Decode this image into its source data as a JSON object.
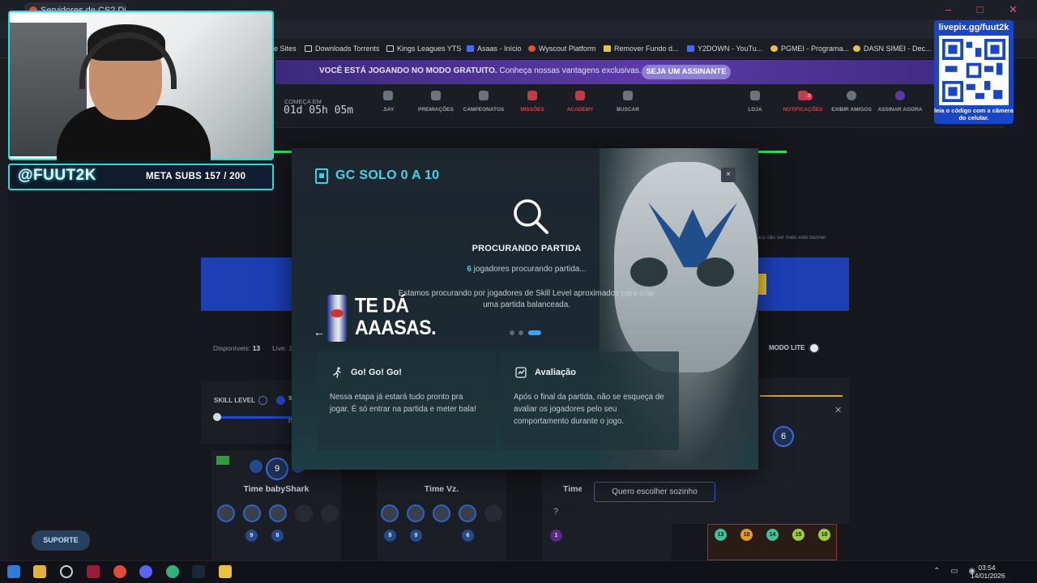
{
  "browser": {
    "tab_title": "Servidores de CS2 Dispo...",
    "window_controls": "– □ ✕",
    "bookmarks": [
      {
        "label": "e Sites",
        "icon": "folder-icon"
      },
      {
        "label": "Downloads Torrents",
        "icon": "folder-icon"
      },
      {
        "label": "Kings Leagues YTS",
        "icon": "folder-icon"
      },
      {
        "label": "Asaas - Início",
        "icon": "asaas-icon"
      },
      {
        "label": "Wyscout Platform",
        "icon": "wyscout-icon"
      },
      {
        "label": "Remover Fundo d...",
        "icon": "remover-icon"
      },
      {
        "label": "Y2DOWN - YouTu...",
        "icon": "y2down-icon"
      },
      {
        "label": "PGMEI - Programa...",
        "icon": "pgmei-icon"
      },
      {
        "label": "DASN SIMEI - Dec...",
        "icon": "dasn-icon"
      }
    ]
  },
  "promo": {
    "text_bold": "VOCÊ ESTÁ JOGANDO NO MODO GRATUITO.",
    "text": " Conheça nossas vantagens exclusivas.",
    "button": "SEJA UM ASSINANTE"
  },
  "nav": {
    "countdown_label": "COMEÇA EM",
    "countdown": "01d 05h 05m",
    "items": [
      {
        "label": ".SAY"
      },
      {
        "label": "PREMIAÇÕES"
      },
      {
        "label": "CAMPEONATOS"
      },
      {
        "label": "MISSÕES"
      },
      {
        "label": "ACADEMY"
      },
      {
        "label": "BUSCAR"
      },
      {
        "label": "LOJA"
      },
      {
        "label": "NOTIFICAÇÕES"
      },
      {
        "label": "EXIBIR AMIGOS"
      },
      {
        "label": "ASSINAR AGORA"
      }
    ],
    "notif_count": "3"
  },
  "overlay": {
    "handle": "@FUUT2K",
    "meta_label": "META SUBS",
    "meta_current": "157",
    "meta_total": "/ 200",
    "qr_title": "livepix.gg/fuut2k",
    "qr_caption": "leia o código com a câmera do celular."
  },
  "page": {
    "banner_note": "ara não ver mais este banner",
    "disponiveis_label": "Disponíveis:",
    "disponiveis_value": "13",
    "live_label": "Live: 1",
    "modo_lite": "MODO LITE",
    "skill_level": "SKILL LEVEL",
    "skill_frag": "s",
    "skill_frag2": "n",
    "teams": [
      {
        "name": "Time babyShark",
        "level": "9",
        "member_levels": [
          "9",
          "8"
        ]
      },
      {
        "name": "Time Vz.",
        "member_levels": [
          "8",
          "9",
          "6"
        ]
      },
      {
        "name": "Time",
        "member_levels": [
          "1"
        ]
      }
    ],
    "right_level": "6",
    "sozinho": "Quero escolher sozinho",
    "bottom_levels": [
      "13",
      "10",
      "14",
      "15",
      "10"
    ],
    "suporte": "SUPORTE"
  },
  "modal": {
    "title": "GC SOLO 0 A 10",
    "status": "PROCURANDO PARTIDA",
    "players_count": "6",
    "players_text": " jogadores procurando partida...",
    "description": "Estamos procurando por jogadores de Skill Level aproximados para criar uma partida balanceada.",
    "ad_headline": "TE DÁ AAASAS.",
    "cards": [
      {
        "title": "Go! Go! Go!",
        "text": "Nessa etapa já estará tudo pronto pra jogar. É só entrar na partida e meter bala!"
      },
      {
        "title": "Avaliação",
        "text": "Após o final da partida, não se esqueça de avaliar os jogadores pelo seu comportamento durante o jogo."
      }
    ],
    "close": "×"
  },
  "taskbar": {
    "time": "03:54",
    "date": "14/01/2026"
  },
  "colors": {
    "accent_cyan": "#3fd7ea",
    "promo_purple": "#5b3aa7",
    "site_blue": "#1c3fb4",
    "overlay_teal": "#1ae0d5"
  }
}
